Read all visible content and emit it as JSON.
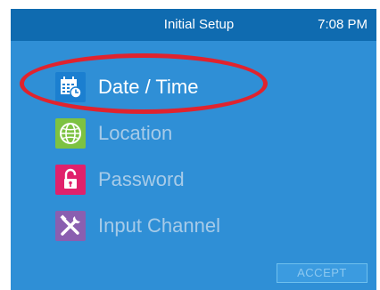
{
  "header": {
    "title": "Initial Setup",
    "time": "7:08 PM"
  },
  "menu": {
    "items": [
      {
        "label": "Date / Time",
        "icon": "calendar-clock-icon",
        "icon_bg": "#1b7fd0",
        "text_color": "#ffffff",
        "selected": true
      },
      {
        "label": "Location",
        "icon": "globe-icon",
        "icon_bg": "#7dc242",
        "text_color": "#a7cbe8",
        "selected": false
      },
      {
        "label": "Password",
        "icon": "lock-icon",
        "icon_bg": "#e0216c",
        "text_color": "#a7cbe8",
        "selected": false
      },
      {
        "label": "Input Channel",
        "icon": "tools-icon",
        "icon_bg": "#8a5fb0",
        "text_color": "#a7cbe8",
        "selected": false
      }
    ]
  },
  "footer": {
    "accept_label": "ACCEPT",
    "accept_text_color": "#8cc8f0"
  },
  "colors": {
    "screen_bg": "#2f8fd6",
    "header_bg": "#0f6bb0",
    "selection_ring": "#e0232e"
  }
}
